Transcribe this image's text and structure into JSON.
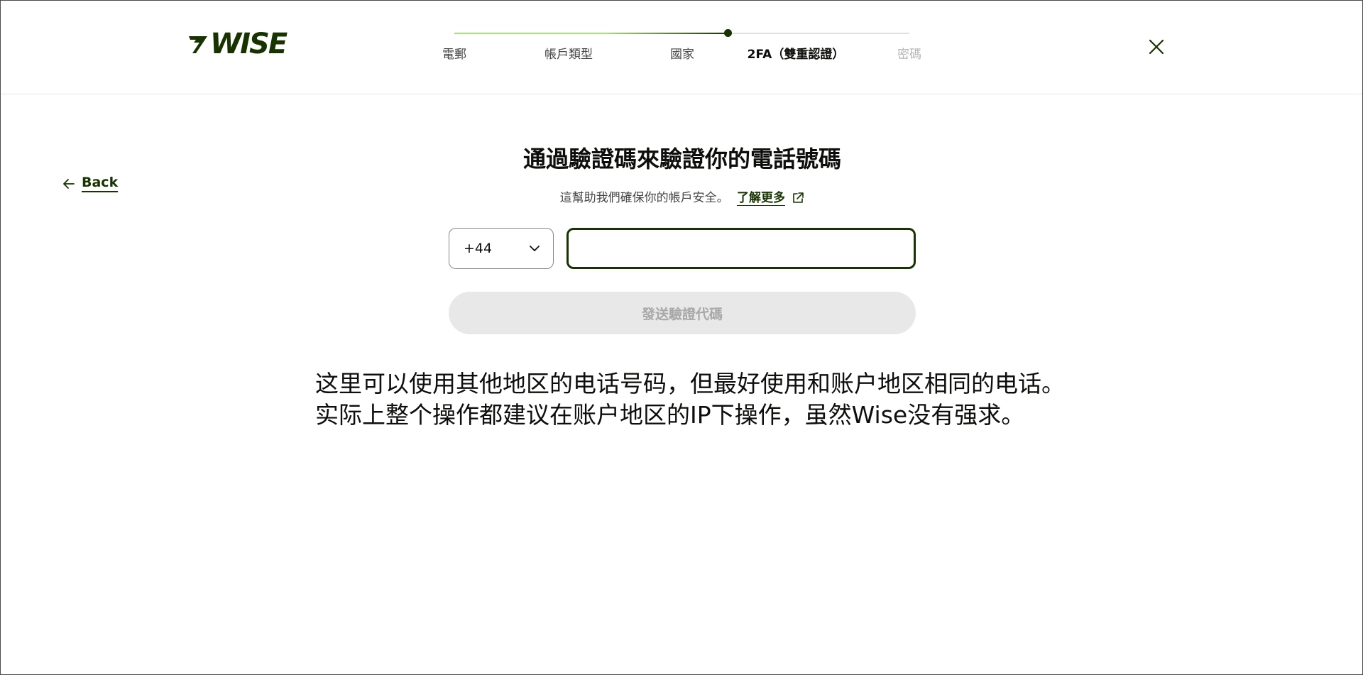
{
  "brand": {
    "logo_text": "WISE",
    "color": "#163300"
  },
  "progress": {
    "fraction": 0.6,
    "steps": [
      {
        "label": "電郵",
        "state": "done"
      },
      {
        "label": "帳戶類型",
        "state": "done"
      },
      {
        "label": "國家",
        "state": "done"
      },
      {
        "label": "2FA（雙重認證）",
        "state": "active"
      },
      {
        "label": "密碼",
        "state": "future"
      }
    ]
  },
  "close_icon": "close-icon",
  "back": {
    "label": "Back",
    "icon": "arrow-left-icon"
  },
  "main": {
    "title": "通過驗證碼來驗證你的電話號碼",
    "subtitle": "這幫助我們確保你的帳戶安全。",
    "learn_more": "了解更多",
    "country_code": "+44",
    "phone_value": "",
    "send_button": "發送驗證代碼"
  },
  "note": {
    "line1": "这里可以使用其他地区的电话号码，但最好使用和账户地区相同的电话。",
    "line2": "实际上整个操作都建议在账户地区的IP下操作，虽然Wise没有强求。"
  },
  "colors": {
    "accent": "#163300",
    "progress_light": "#9fe870",
    "disabled_bg": "#e8e8e8",
    "disabled_text": "#a8a8a8"
  }
}
